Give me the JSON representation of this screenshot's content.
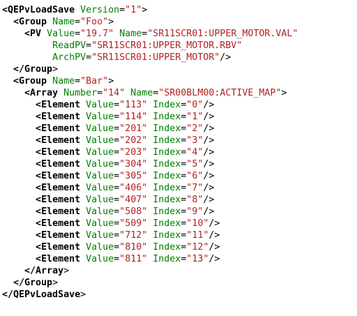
{
  "colors": {
    "background": "#ffffff",
    "tag": "#000000",
    "attribute": "#008000",
    "value": "#b22222",
    "punctuation": "#000000"
  },
  "lines": [
    {
      "indent": 0,
      "close": false,
      "tag": "QEPvLoadSave",
      "attrs": [
        {
          "name": "Version",
          "value": "1"
        }
      ],
      "end": ">"
    },
    {
      "indent": 2,
      "close": false,
      "tag": "Group",
      "attrs": [
        {
          "name": "Name",
          "value": "Foo"
        }
      ],
      "end": ">"
    },
    {
      "indent": 4,
      "close": false,
      "tag": "PV",
      "attrs": [
        {
          "name": "Value",
          "value": "19.7"
        },
        {
          "name": "Name",
          "value": "SR11SCR01:UPPER_MOTOR.VAL"
        }
      ],
      "end": ""
    },
    {
      "indent": 8,
      "close": false,
      "tag": "",
      "attrs": [
        {
          "name": "ReadPV",
          "value": "SR11SCR01:UPPER_MOTOR.RBV"
        }
      ],
      "end": ""
    },
    {
      "indent": 8,
      "close": false,
      "tag": "",
      "attrs": [
        {
          "name": "ArchPV",
          "value": "SR11SCR01:UPPER_MOTOR"
        }
      ],
      "end": "/>"
    },
    {
      "indent": 2,
      "close": true,
      "tag": "Group",
      "attrs": [],
      "end": ">"
    },
    {
      "indent": 2,
      "close": false,
      "tag": "Group",
      "attrs": [
        {
          "name": "Name",
          "value": "Bar"
        }
      ],
      "end": ">"
    },
    {
      "indent": 4,
      "close": false,
      "tag": "Array",
      "attrs": [
        {
          "name": "Number",
          "value": "14"
        },
        {
          "name": "Name",
          "value": "SR00BLM00:ACTIVE_MAP"
        }
      ],
      "end": ">"
    },
    {
      "indent": 6,
      "close": false,
      "tag": "Element",
      "attrs": [
        {
          "name": "Value",
          "value": "113"
        },
        {
          "name": "Index",
          "value": "0"
        }
      ],
      "end": "/>"
    },
    {
      "indent": 6,
      "close": false,
      "tag": "Element",
      "attrs": [
        {
          "name": "Value",
          "value": "114"
        },
        {
          "name": "Index",
          "value": "1"
        }
      ],
      "end": "/>"
    },
    {
      "indent": 6,
      "close": false,
      "tag": "Element",
      "attrs": [
        {
          "name": "Value",
          "value": "201"
        },
        {
          "name": "Index",
          "value": "2"
        }
      ],
      "end": "/>"
    },
    {
      "indent": 6,
      "close": false,
      "tag": "Element",
      "attrs": [
        {
          "name": "Value",
          "value": "202"
        },
        {
          "name": "Index",
          "value": "3"
        }
      ],
      "end": "/>"
    },
    {
      "indent": 6,
      "close": false,
      "tag": "Element",
      "attrs": [
        {
          "name": "Value",
          "value": "203"
        },
        {
          "name": "Index",
          "value": "4"
        }
      ],
      "end": "/>"
    },
    {
      "indent": 6,
      "close": false,
      "tag": "Element",
      "attrs": [
        {
          "name": "Value",
          "value": "304"
        },
        {
          "name": "Index",
          "value": "5"
        }
      ],
      "end": "/>"
    },
    {
      "indent": 6,
      "close": false,
      "tag": "Element",
      "attrs": [
        {
          "name": "Value",
          "value": "305"
        },
        {
          "name": "Index",
          "value": "6"
        }
      ],
      "end": "/>"
    },
    {
      "indent": 6,
      "close": false,
      "tag": "Element",
      "attrs": [
        {
          "name": "Value",
          "value": "406"
        },
        {
          "name": "Index",
          "value": "7"
        }
      ],
      "end": "/>"
    },
    {
      "indent": 6,
      "close": false,
      "tag": "Element",
      "attrs": [
        {
          "name": "Value",
          "value": "407"
        },
        {
          "name": "Index",
          "value": "8"
        }
      ],
      "end": "/>"
    },
    {
      "indent": 6,
      "close": false,
      "tag": "Element",
      "attrs": [
        {
          "name": "Value",
          "value": "508"
        },
        {
          "name": "Index",
          "value": "9"
        }
      ],
      "end": "/>"
    },
    {
      "indent": 6,
      "close": false,
      "tag": "Element",
      "attrs": [
        {
          "name": "Value",
          "value": "509"
        },
        {
          "name": "Index",
          "value": "10"
        }
      ],
      "end": "/>"
    },
    {
      "indent": 6,
      "close": false,
      "tag": "Element",
      "attrs": [
        {
          "name": "Value",
          "value": "712"
        },
        {
          "name": "Index",
          "value": "11"
        }
      ],
      "end": "/>"
    },
    {
      "indent": 6,
      "close": false,
      "tag": "Element",
      "attrs": [
        {
          "name": "Value",
          "value": "810"
        },
        {
          "name": "Index",
          "value": "12"
        }
      ],
      "end": "/>"
    },
    {
      "indent": 6,
      "close": false,
      "tag": "Element",
      "attrs": [
        {
          "name": "Value",
          "value": "811"
        },
        {
          "name": "Index",
          "value": "13"
        }
      ],
      "end": "/>"
    },
    {
      "indent": 4,
      "close": true,
      "tag": "Array",
      "attrs": [],
      "end": ">"
    },
    {
      "indent": 2,
      "close": true,
      "tag": "Group",
      "attrs": [],
      "end": ">"
    },
    {
      "indent": 0,
      "close": true,
      "tag": "QEPvLoadSave",
      "attrs": [],
      "end": ">"
    }
  ]
}
